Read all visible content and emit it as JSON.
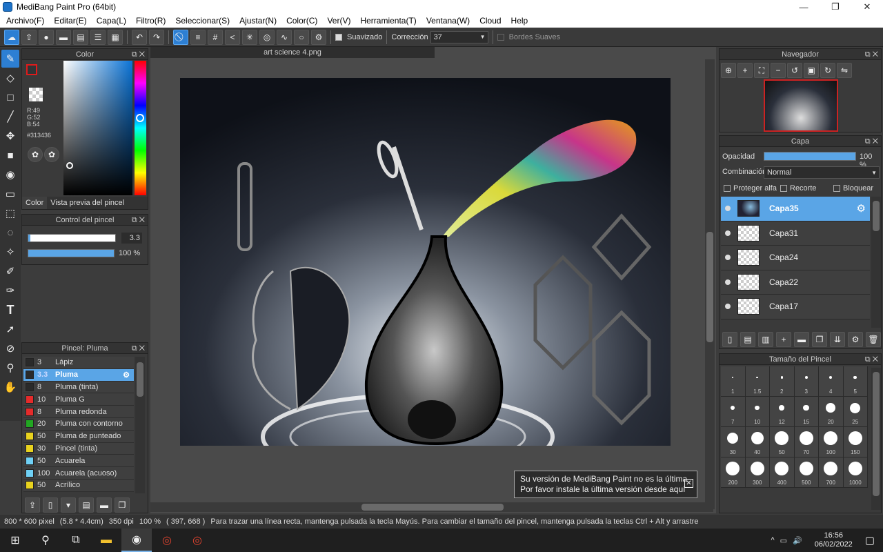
{
  "window": {
    "title": "MediBang Paint Pro (64bit)",
    "minimize": "—",
    "maximize": "❐",
    "close": "✕"
  },
  "menu": [
    "Archivo(F)",
    "Editar(E)",
    "Capa(L)",
    "Filtro(R)",
    "Seleccionar(S)",
    "Ajustar(N)",
    "Color(C)",
    "Ver(V)",
    "Herramienta(T)",
    "Ventana(W)",
    "Cloud",
    "Help"
  ],
  "toolbar": {
    "smoothing_label": "Suavizado",
    "correction_label": "Corrección",
    "correction_value": "37",
    "soft_edges_label": "Bordes Suaves"
  },
  "color_panel": {
    "title": "Color",
    "r": "R:49",
    "g": "G:52",
    "b": "B:54",
    "hex": "#313436",
    "tab_color": "Color",
    "tab_preview": "Vista previa del pincel",
    "primary": "#313436"
  },
  "brush_control": {
    "title": "Control del pincel",
    "size": "3.3",
    "opacity": "100 %",
    "size_fraction": 0.02,
    "opacity_fraction": 1.0
  },
  "brush_panel": {
    "title": "Pincel: Pluma",
    "brushes": [
      {
        "size": "3",
        "name": "Lápiz",
        "color": "#2a2a2a",
        "selected": false
      },
      {
        "size": "3.3",
        "name": "Pluma",
        "color": "#2a2a2a",
        "selected": true
      },
      {
        "size": "8",
        "name": "Pluma (tinta)",
        "color": "#2a2a2a",
        "selected": false
      },
      {
        "size": "10",
        "name": "Pluma G",
        "color": "#e52b2b",
        "selected": false
      },
      {
        "size": "8",
        "name": "Pluma redonda",
        "color": "#e52b2b",
        "selected": false
      },
      {
        "size": "20",
        "name": "Pluma con contorno",
        "color": "#22a722",
        "selected": false
      },
      {
        "size": "50",
        "name": "Pluma de punteado",
        "color": "#e8d21e",
        "selected": false
      },
      {
        "size": "30",
        "name": "Pincel (tinta)",
        "color": "#e8d21e",
        "selected": false
      },
      {
        "size": "50",
        "name": "Acuarela",
        "color": "#6fd0f5",
        "selected": false
      },
      {
        "size": "100",
        "name": "Acuarela (acuoso)",
        "color": "#6fd0f5",
        "selected": false
      },
      {
        "size": "50",
        "name": "Acrílico",
        "color": "#e8d21e",
        "selected": false
      }
    ]
  },
  "document": {
    "tab": "art science 4.png"
  },
  "navigator": {
    "title": "Navegador"
  },
  "layer_panel": {
    "title": "Capa",
    "opacity_label": "Opacidad",
    "opacity_value": "100 %",
    "opacity_fraction": 1.0,
    "blend_label": "Combinación",
    "blend_value": "Normal",
    "protect_alpha": "Proteger alfa",
    "clipping": "Recorte",
    "lock": "Bloquear",
    "layers": [
      {
        "name": "Capa35",
        "selected": true
      },
      {
        "name": "Capa31",
        "selected": false
      },
      {
        "name": "Capa24",
        "selected": false
      },
      {
        "name": "Capa22",
        "selected": false
      },
      {
        "name": "Capa17",
        "selected": false
      }
    ]
  },
  "brush_size_panel": {
    "title": "Tamaño del Pincel",
    "sizes": [
      "1",
      "1.5",
      "2",
      "3",
      "4",
      "5",
      "7",
      "10",
      "12",
      "15",
      "20",
      "25",
      "30",
      "40",
      "50",
      "70",
      "100",
      "150",
      "200",
      "300",
      "400",
      "500",
      "700",
      "1000"
    ]
  },
  "notice": {
    "line1": "Su versión de MediBang Paint no es la última",
    "line2": "Por favor instale la última versión desde aquí"
  },
  "status": {
    "dims": "800 * 600 pixel",
    "cm": "(5.8 * 4.4cm)",
    "dpi": "350 dpi",
    "zoom": "100 %",
    "coords": "( 397, 668 )",
    "hint": "Para trazar una línea recta, mantenga pulsada la tecla Mayús. Para cambiar el tamaño del pincel, mantenga pulsada la teclas Ctrl + Alt y arrastre"
  },
  "taskbar": {
    "time": "16:56",
    "date": "06/02/2022"
  }
}
